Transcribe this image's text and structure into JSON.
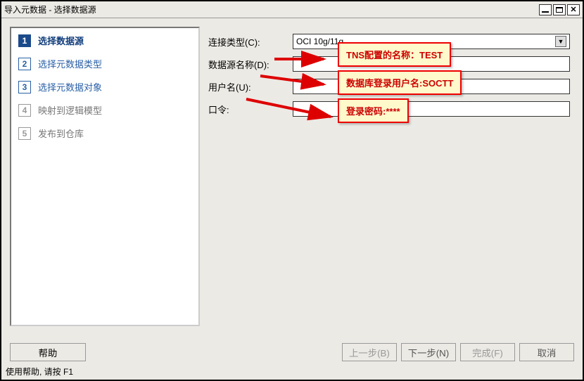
{
  "window": {
    "title": "导入元数据 - 选择数据源"
  },
  "steps": {
    "items": [
      {
        "num": "1",
        "label": "选择数据源",
        "state": "active"
      },
      {
        "num": "2",
        "label": "选择元数据类型",
        "state": "pending"
      },
      {
        "num": "3",
        "label": "选择元数据对象",
        "state": "pending"
      },
      {
        "num": "4",
        "label": "映射到逻辑模型",
        "state": "future"
      },
      {
        "num": "5",
        "label": "发布到仓库",
        "state": "future"
      }
    ]
  },
  "form": {
    "connection_type_label": "连接类型(C):",
    "connection_type_value": "OCI 10g/11g",
    "datasource_label": "数据源名称(D):",
    "datasource_value": "",
    "username_label": "用户名(U):",
    "username_value": "",
    "password_label": "口令:",
    "password_value": ""
  },
  "annotations": {
    "callout1": "TNS配置的名称：TEST",
    "callout2": "数据库登录用户名:SOCTT",
    "callout3": "登录密码:****"
  },
  "buttons": {
    "help": "帮助",
    "prev": "上一步(B)",
    "next": "下一步(N)",
    "finish": "完成(F)",
    "cancel": "取消"
  },
  "status": {
    "text": "使用帮助, 请按 F1"
  }
}
